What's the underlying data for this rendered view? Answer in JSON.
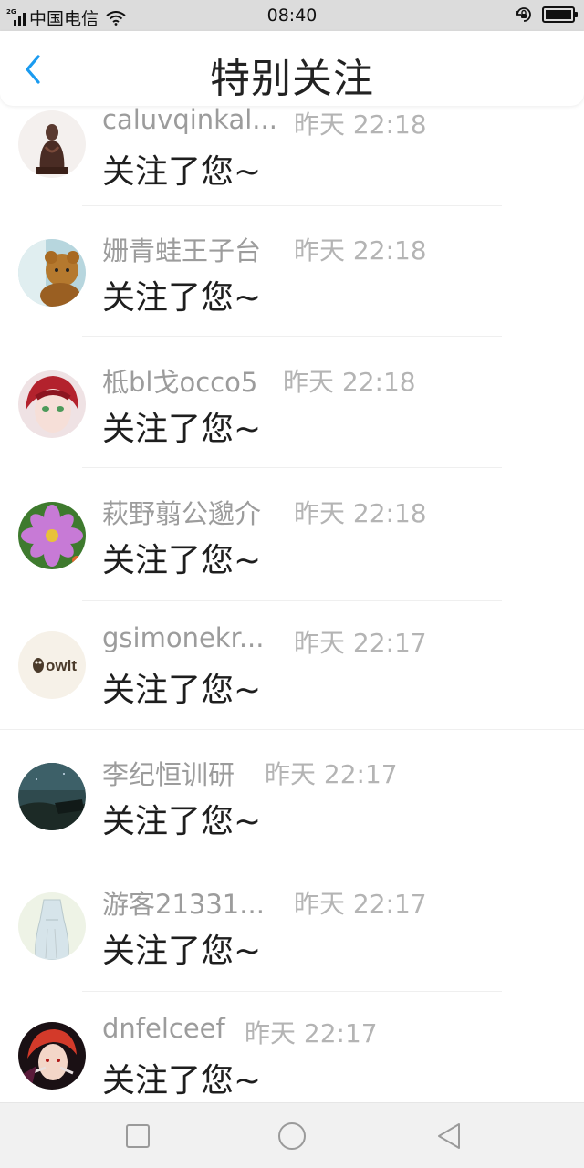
{
  "status_bar": {
    "network_tag": "2G",
    "carrier": "中国电信",
    "time": "08:40",
    "icons": [
      "signal-icon",
      "wifi-icon",
      "rotation-lock-icon",
      "battery-icon"
    ]
  },
  "header": {
    "title": "特别关注",
    "back_icon": "chevron-left-icon",
    "accent_color": "#1a9bf0"
  },
  "items": [
    {
      "name": "caluvqinkal...",
      "time": "昨天 22:18",
      "message": "关注了您~",
      "avatar": "statue"
    },
    {
      "name": "姗青蛙王子台",
      "time": "昨天 22:18",
      "message": "关注了您~",
      "avatar": "teddy-bear"
    },
    {
      "name": "柢bl戈occo5",
      "time": "昨天 22:18",
      "message": "关注了您~",
      "avatar": "anime-red-hair"
    },
    {
      "name": "萩野翦公邈介",
      "time": "昨天 22:18",
      "message": "关注了您~",
      "avatar": "pink-flower"
    },
    {
      "name": "gsimonekr...",
      "time": "昨天 22:17",
      "message": "关注了您~",
      "avatar": "owlt-logo",
      "avatar_text": "owlt"
    },
    {
      "name": "李纪恒训研",
      "time": "昨天 22:17",
      "message": "关注了您~",
      "avatar": "night-landscape"
    },
    {
      "name": "游客21331...",
      "time": "昨天 22:17",
      "message": "关注了您~",
      "avatar": "sketch-dress"
    },
    {
      "name": "dnfelceef",
      "time": "昨天 22:17",
      "message": "关注了您~",
      "avatar": "anime-dark"
    }
  ],
  "system_nav": {
    "icons": [
      "recent-apps-icon",
      "home-icon",
      "back-icon"
    ]
  }
}
